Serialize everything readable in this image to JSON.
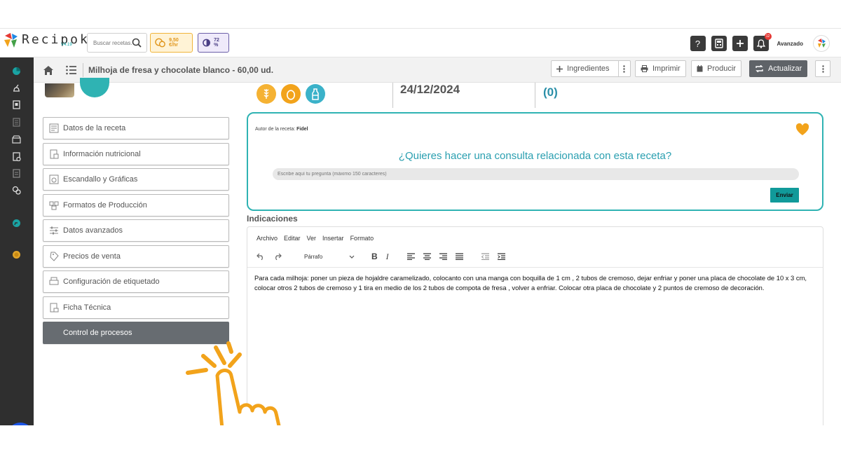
{
  "app": {
    "logo_text": "Recipok",
    "version": "V4.19"
  },
  "topbar": {
    "search_placeholder": "Buscar recetas...",
    "cost_label": "9,50 €/hr",
    "percent_label": "72 %",
    "notification_count": "12",
    "level_label": "Avanzado",
    "icons": [
      "help-icon",
      "calculator-icon",
      "plus-icon",
      "bell-icon"
    ]
  },
  "breadcrumb": {
    "title": "Milhoja de fresa y chocolate blanco - 60,00 ud.",
    "buttons": {
      "ingredientes": "Ingredientes",
      "imprimir": "Imprimir",
      "producir": "Producir",
      "actualizar": "Actualizar"
    }
  },
  "menu": {
    "items": [
      {
        "label": "Datos de la receta",
        "icon": "recipe-card-icon"
      },
      {
        "label": "Información nutricional",
        "icon": "nutrition-icon"
      },
      {
        "label": "Escandallo y Gráficas",
        "icon": "chart-icon"
      },
      {
        "label": "Formatos de Producción",
        "icon": "boxes-icon"
      },
      {
        "label": "Datos avanzados",
        "icon": "sliders-icon"
      },
      {
        "label": "Precios de venta",
        "icon": "price-tag-icon"
      },
      {
        "label": "Configuración de etiquetado",
        "icon": "label-printer-icon"
      },
      {
        "label": "Ficha Técnica",
        "icon": "tech-sheet-icon"
      },
      {
        "label": "Control de procesos",
        "icon": "",
        "active": true
      }
    ]
  },
  "summary": {
    "date": "24/12/2024",
    "count": "(0)",
    "allergens": [
      "gluten-icon",
      "egg-icon",
      "milk-icon"
    ]
  },
  "consult": {
    "author_prefix": "Autor de la receta:",
    "author_name": "Fidel",
    "title": "¿Quieres hacer una consulta relacionada con esta receta?",
    "input_placeholder": "Escribe aquí tu pregunta (máximo 150 caracteres)",
    "send_label": "Enviar"
  },
  "indications": {
    "label": "Indicaciones",
    "menu": [
      "Archivo",
      "Editar",
      "Ver",
      "Insertar",
      "Formato"
    ],
    "format_select": "Párrafo",
    "body": "Para cada milhoja: poner un pieza de hojaldre caramelizado, colocanto con una manga con boquilla de 1 cm , 2 tubos de cremoso, dejar enfriar y poner una placa de chocolate de 10 x 3 cm, colocar otros 2 tubos de cremoso y 1 tira en medio de los 2 tubos de compota de fresa , volver a enfriar. Colocar otra placa de chocolate y 2 puntos de cremoso de decoración."
  },
  "colors": {
    "teal": "#2fb3b3",
    "sidebar": "#2f2f2f",
    "accent_orange": "#f2a31b",
    "active_menu": "#676c71"
  }
}
